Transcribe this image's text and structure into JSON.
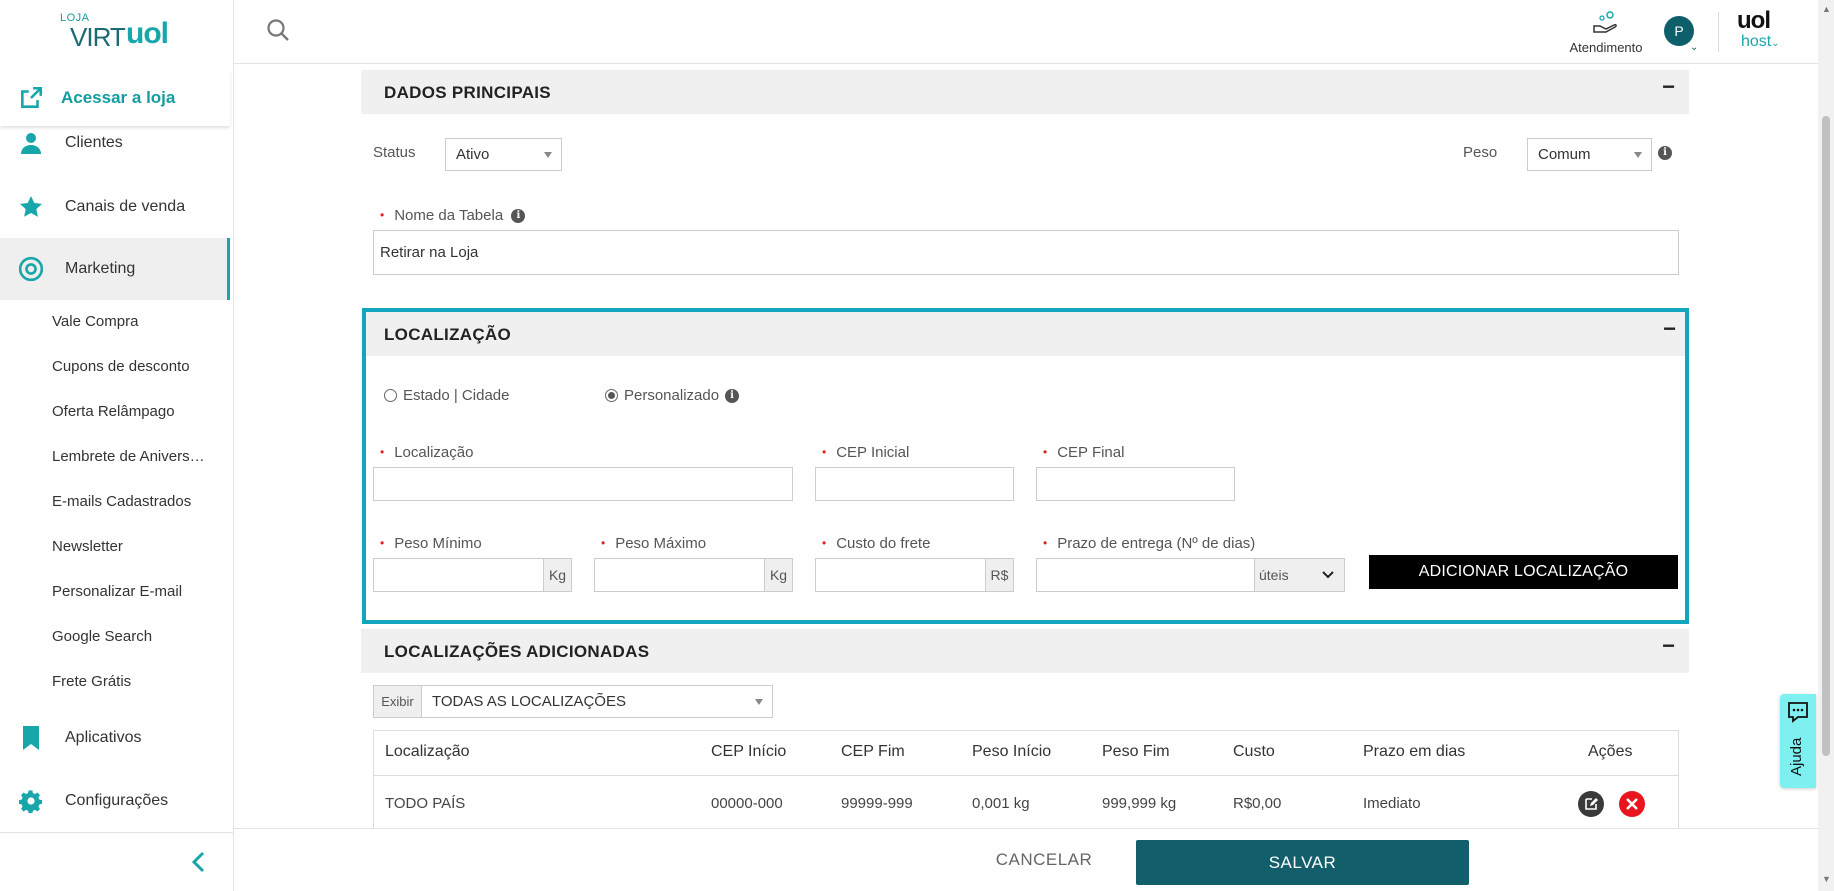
{
  "brand": {
    "small": "LOJA",
    "virt": "VIRT",
    "uol": "uol"
  },
  "sidebar": {
    "acessar": "Acessar a loja",
    "items": [
      {
        "label": "Clientes"
      },
      {
        "label": "Canais de venda"
      },
      {
        "label": "Marketing"
      },
      {
        "label": "Aplicativos"
      },
      {
        "label": "Configurações"
      }
    ],
    "marketing_sub": [
      "Vale Compra",
      "Cupons de desconto",
      "Oferta Relâmpago",
      "Lembrete de Anivers…",
      "E-mails Cadastrados",
      "Newsletter",
      "Personalizar E-mail",
      "Google Search",
      "Frete Grátis"
    ]
  },
  "header": {
    "atendimento": "Atendimento",
    "avatar": "P",
    "host_uol": "uol",
    "host_host": "host"
  },
  "dados": {
    "title": "DADOS PRINCIPAIS",
    "collapse": "−",
    "status_label": "Status",
    "status_value": "Ativo",
    "peso_label": "Peso",
    "peso_value": "Comum",
    "nome_label": "Nome da Tabela",
    "nome_value": "Retirar na Loja"
  },
  "localizacao": {
    "title": "LOCALIZAÇÃO",
    "collapse": "−",
    "radio_estado": "Estado | Cidade",
    "radio_personalizado": "Personalizado",
    "loc_label": "Localização",
    "cep_ini_label": "CEP Inicial",
    "cep_fim_label": "CEP Final",
    "peso_min_label": "Peso Mínimo",
    "peso_max_label": "Peso Máximo",
    "custo_label": "Custo do frete",
    "prazo_label": "Prazo de entrega (Nº de dias)",
    "kg": "Kg",
    "rs": "R$",
    "uteis": "úteis",
    "add_button": "ADICIONAR LOCALIZAÇÃO"
  },
  "adicionadas": {
    "title": "LOCALIZAÇÕES ADICIONADAS",
    "collapse": "−",
    "exibir": "Exibir",
    "filter_value": "TODAS AS LOCALIZAÇÕES",
    "columns": [
      "Localização",
      "CEP Início",
      "CEP Fim",
      "Peso Início",
      "Peso Fim",
      "Custo",
      "Prazo em dias",
      "Ações"
    ],
    "row": [
      "TODO PAÍS",
      "00000-000",
      "99999-999",
      "0,001 kg",
      "999,999 kg",
      "R$0,00",
      "Imediato"
    ]
  },
  "footer": {
    "cancel": "CANCELAR",
    "save": "SALVAR"
  },
  "ajuda": "Ajuda",
  "colors": {
    "teal": "#17a6a9",
    "dark_teal": "#125f6b",
    "highlight": "#13a4be",
    "danger": "#e02020"
  }
}
